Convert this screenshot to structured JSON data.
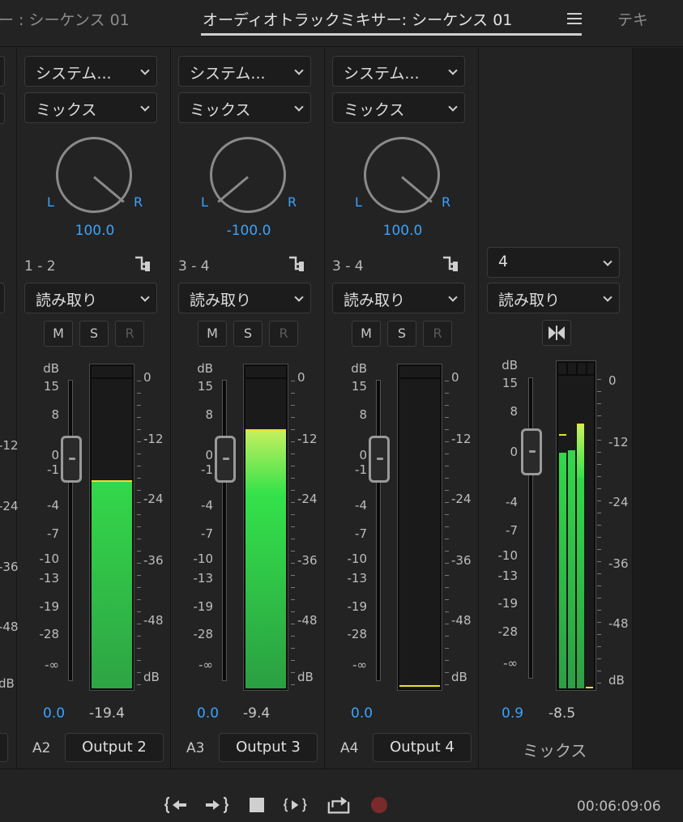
{
  "tabs": {
    "left": "ー : シーケンス 01",
    "active": "オーディオトラックミキサー: シーケンス 01",
    "right": "テキ"
  },
  "partial_strip": {
    "scale_labels": [
      "-12",
      "-24",
      "-36",
      "-48",
      "dB"
    ]
  },
  "strips": [
    {
      "input": "システム...",
      "effect": "ミックス",
      "pan_value": "100.0",
      "pan_left": "L",
      "pan_right": "R",
      "routing": "1 - 2",
      "automation": "読み取り",
      "mute": "M",
      "solo": "S",
      "record": "R",
      "fader_value": "0.0",
      "peak_value": "-19.4",
      "level_db": -19.4,
      "track_name": "A2",
      "output": "Output 2"
    },
    {
      "input": "システム...",
      "effect": "ミックス",
      "pan_value": "-100.0",
      "pan_left": "L",
      "pan_right": "R",
      "routing": "3 - 4",
      "automation": "読み取り",
      "mute": "M",
      "solo": "S",
      "record": "R",
      "fader_value": "0.0",
      "peak_value": "-9.4",
      "level_db": -9.4,
      "track_name": "A3",
      "output": "Output 3"
    },
    {
      "input": "システム...",
      "effect": "ミックス",
      "pan_value": "100.0",
      "pan_left": "L",
      "pan_right": "R",
      "routing": "3 - 4",
      "automation": "読み取り",
      "mute": "M",
      "solo": "S",
      "record": "R",
      "fader_value": "0.0",
      "peak_value": "",
      "level_db": null,
      "track_name": "A4",
      "output": "Output 4"
    }
  ],
  "master": {
    "channels": "4",
    "automation": "読み取り",
    "fader_value": "0.9",
    "peak_value": "-8.5",
    "name": "ミックス"
  },
  "scale": {
    "left": [
      "dB",
      "15",
      "8",
      "0",
      "-1",
      "-4",
      "-7",
      "-10",
      "-13",
      "-19",
      "-28",
      "-∞"
    ],
    "right": [
      "0",
      "-12",
      "-24",
      "-36",
      "-48",
      "dB"
    ]
  },
  "transport": {
    "timecode": "00:06:09:06",
    "buttons": [
      "go-to-in",
      "go-to-out",
      "stop",
      "play-in-to-out",
      "loop",
      "record"
    ],
    "record_color": "#7a2a2a"
  },
  "colors": {
    "accent": "#3aa3ff",
    "meter_green": "#33d24a",
    "meter_yellow": "#e8e032"
  }
}
